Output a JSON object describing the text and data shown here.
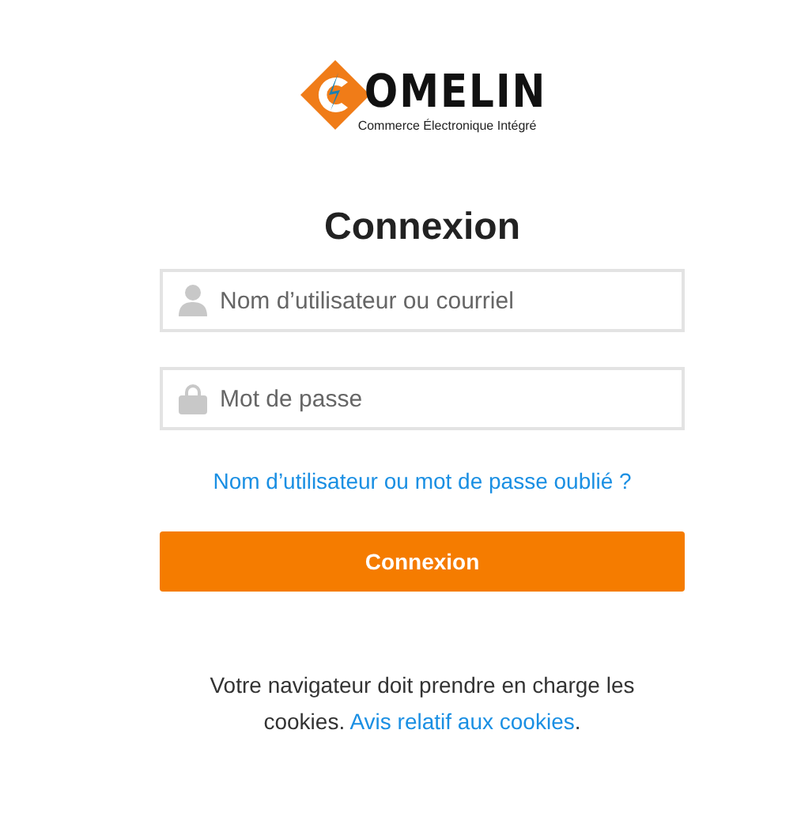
{
  "logo": {
    "wordmark": "OMELIN",
    "tagline": "Commerce Électronique Intégré"
  },
  "title": "Connexion",
  "fields": [
    {
      "kind": "user",
      "placeholder": "Nom d’utilisateur ou courriel"
    },
    {
      "kind": "password",
      "placeholder": "Mot de passe"
    }
  ],
  "forgot_link": "Nom d’utilisateur ou mot de passe oublié ?",
  "submit_button": "Connexion",
  "notice": {
    "text": "Votre navigateur doit prendre en charge les cookies.",
    "link": "Avis relatif aux cookies",
    "end": "."
  }
}
